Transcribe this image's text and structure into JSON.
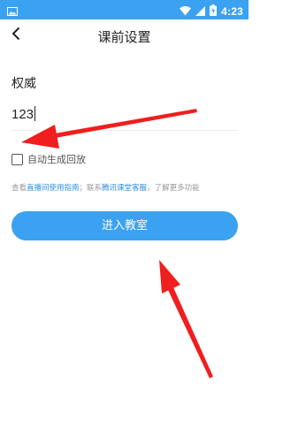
{
  "status_bar": {
    "time": "4:23",
    "icons": [
      "gallery-notification-icon",
      "wifi-icon",
      "cellular-signal-icon",
      "battery-charging-icon"
    ],
    "background": "#3aa2f0"
  },
  "header": {
    "title": "课前设置",
    "back_icon": "chevron-left-icon"
  },
  "form": {
    "name_label": "权威",
    "password_value": "123",
    "auto_replay_label": "自动生成回放",
    "auto_replay_checked": false
  },
  "info": {
    "prefix": "查看",
    "guide_link": "直播间使用指南",
    "middle": "；联系",
    "support_link": "腾讯课堂客服",
    "suffix": "，了解更多功能"
  },
  "enter_button": {
    "label": "进入教室"
  },
  "colors": {
    "accent": "#3aa2f0",
    "link": "#2f8fe0",
    "annotation_arrow": "#f01e1e"
  }
}
